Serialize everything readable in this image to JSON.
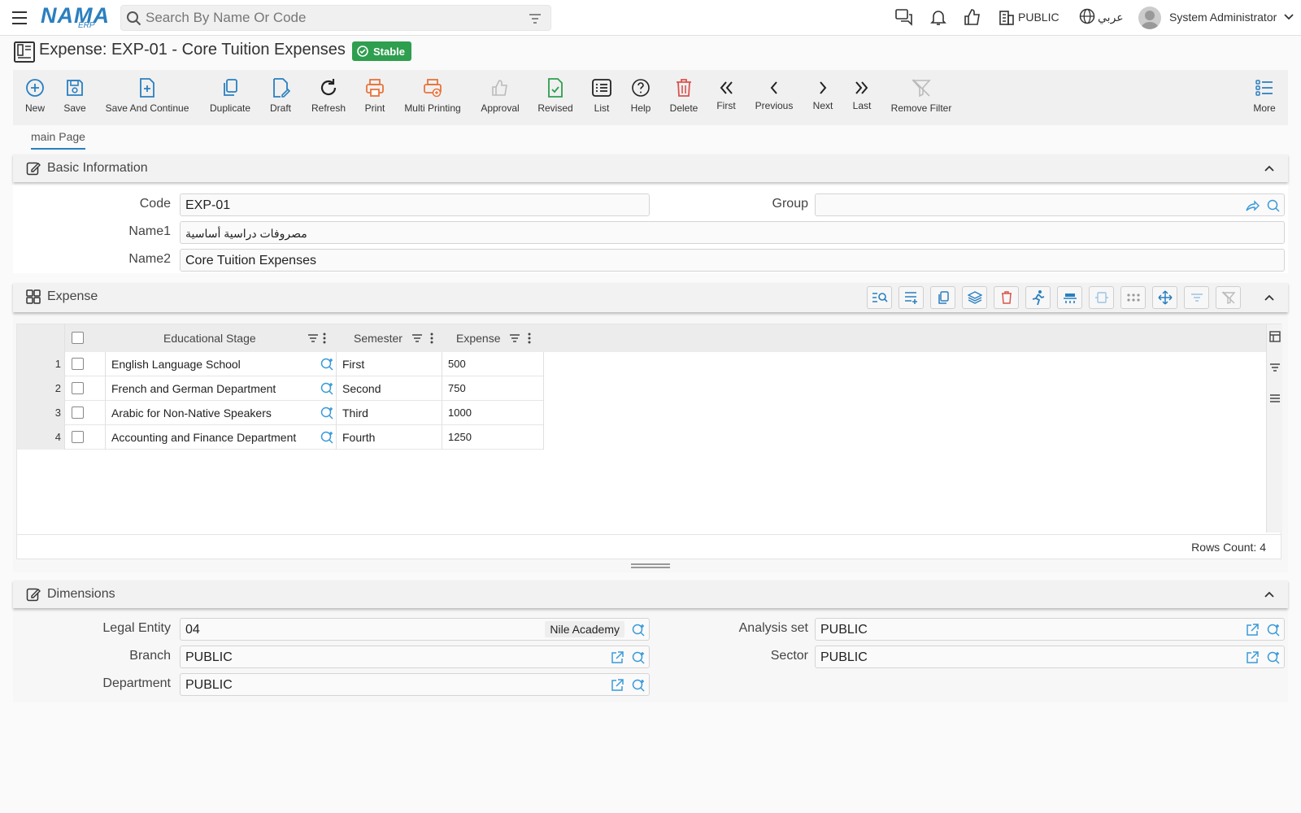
{
  "app": {
    "logo_main": "NAMA",
    "logo_sub": "ERP"
  },
  "topbar": {
    "search_placeholder": "Search By Name Or Code",
    "public_label": "PUBLIC",
    "language_label": "عربي",
    "user_name": "System Administrator"
  },
  "page": {
    "title": "Expense: EXP-01 - Core Tuition Expenses",
    "status_badge": "Stable"
  },
  "toolbar": {
    "new": "New",
    "save": "Save",
    "save_continue": "Save And Continue",
    "duplicate": "Duplicate",
    "draft": "Draft",
    "refresh": "Refresh",
    "print": "Print",
    "multi_printing": "Multi Printing",
    "approval": "Approval",
    "revised": "Revised",
    "list": "List",
    "help": "Help",
    "delete": "Delete",
    "first": "First",
    "previous": "Previous",
    "next": "Next",
    "last": "Last",
    "remove_filter": "Remove Filter",
    "more": "More"
  },
  "tabs": {
    "main": "main Page"
  },
  "basic_info": {
    "title": "Basic Information",
    "code_label": "Code",
    "code_value": "EXP-01",
    "group_label": "Group",
    "group_value": "",
    "name1_label": "Name1",
    "name1_value": "مصروفات دراسية أساسية",
    "name2_label": "Name2",
    "name2_value": "Core Tuition Expenses"
  },
  "expense_grid": {
    "title": "Expense",
    "columns": {
      "stage": "Educational Stage",
      "semester": "Semester",
      "expense": "Expense"
    },
    "rows": [
      {
        "num": "1",
        "stage": "English Language School",
        "semester": "First",
        "expense": "500"
      },
      {
        "num": "2",
        "stage": "French and German Department",
        "semester": "Second",
        "expense": "750"
      },
      {
        "num": "3",
        "stage": "Arabic for Non-Native Speakers",
        "semester": "Third",
        "expense": "1000"
      },
      {
        "num": "4",
        "stage": "Accounting and Finance Department",
        "semester": "Fourth",
        "expense": "1250"
      }
    ],
    "rows_count": "Rows Count: 4"
  },
  "dimensions": {
    "title": "Dimensions",
    "legal_entity_label": "Legal Entity",
    "legal_entity_value": "04",
    "legal_entity_name": "Nile Academy",
    "branch_label": "Branch",
    "branch_value": "PUBLIC",
    "department_label": "Department",
    "department_value": "PUBLIC",
    "analysis_set_label": "Analysis set",
    "analysis_set_value": "PUBLIC",
    "sector_label": "Sector",
    "sector_value": "PUBLIC"
  },
  "colors": {
    "accent": "#2a7fbf",
    "status_green": "#2e9e4f",
    "print_orange": "#e8743b",
    "delete_red": "#d9534f"
  }
}
